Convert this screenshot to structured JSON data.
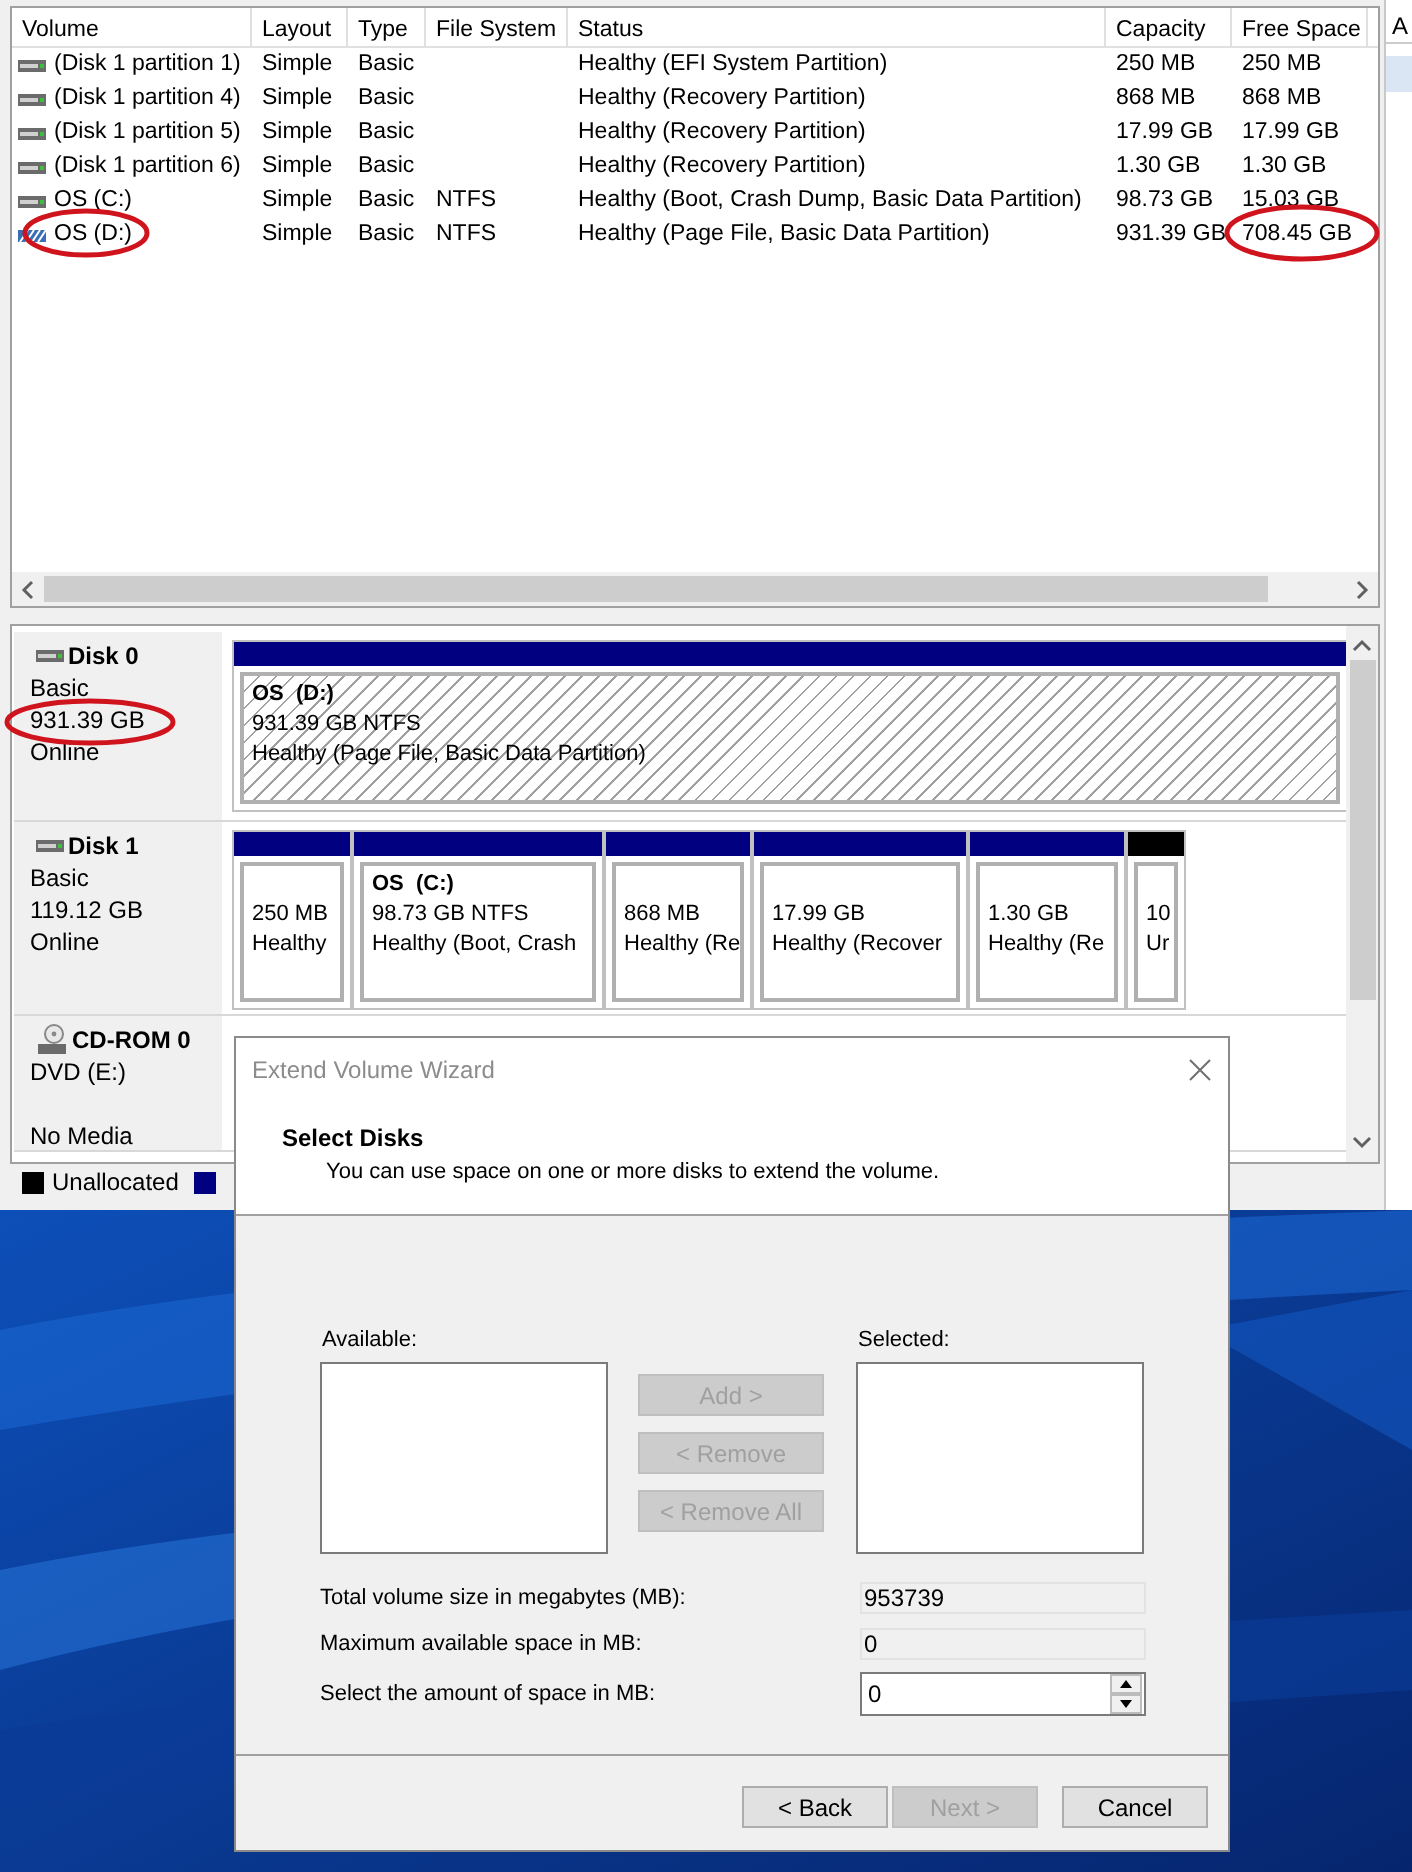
{
  "volume_list": {
    "columns": [
      "Volume",
      "Layout",
      "Type",
      "File System",
      "Status",
      "Capacity",
      "Free Space"
    ],
    "rows": [
      {
        "kind": "simple",
        "cells": [
          "(Disk 1 partition 1)",
          "Simple",
          "Basic",
          "",
          "Healthy (EFI System Partition)",
          "250 MB",
          "250 MB"
        ]
      },
      {
        "kind": "simple",
        "cells": [
          "(Disk 1 partition 4)",
          "Simple",
          "Basic",
          "",
          "Healthy (Recovery Partition)",
          "868 MB",
          "868 MB"
        ]
      },
      {
        "kind": "simple",
        "cells": [
          "(Disk 1 partition 5)",
          "Simple",
          "Basic",
          "",
          "Healthy (Recovery Partition)",
          "17.99 GB",
          "17.99 GB"
        ]
      },
      {
        "kind": "simple",
        "cells": [
          "(Disk 1 partition 6)",
          "Simple",
          "Basic",
          "",
          "Healthy (Recovery Partition)",
          "1.30 GB",
          "1.30 GB"
        ]
      },
      {
        "kind": "simple",
        "cells": [
          "OS (C:)",
          "Simple",
          "Basic",
          "NTFS",
          "Healthy (Boot, Crash Dump, Basic Data Partition)",
          "98.73 GB",
          "15.03 GB"
        ]
      },
      {
        "kind": "spanned",
        "cells": [
          "OS (D:)",
          "Simple",
          "Basic",
          "NTFS",
          "Healthy (Page File, Basic Data Partition)",
          "931.39 GB",
          "708.45 GB"
        ]
      }
    ]
  },
  "disks": [
    {
      "kind": "disk",
      "name": "Disk 0",
      "lines": [
        "Basic",
        "931.39 GB",
        "Online"
      ],
      "partitions": [
        {
          "kind": "spanned",
          "title": "OS  (D:)",
          "lines": [
            "931.39 GB NTFS",
            "Healthy (Page File, Basic Data Partition)"
          ]
        }
      ]
    },
    {
      "kind": "disk",
      "name": "Disk 1",
      "lines": [
        "Basic",
        "119.12 GB",
        "Online"
      ],
      "partitions": [
        {
          "kind": "primary",
          "lines": [
            "250 MB",
            "Healthy"
          ]
        },
        {
          "kind": "primary",
          "title": "OS  (C:)",
          "lines": [
            "98.73 GB NTFS",
            "Healthy (Boot, Crash"
          ]
        },
        {
          "kind": "primary",
          "lines": [
            "868 MB",
            "Healthy (Re"
          ]
        },
        {
          "kind": "primary",
          "lines": [
            "17.99 GB",
            "Healthy (Recover"
          ]
        },
        {
          "kind": "primary",
          "lines": [
            "1.30 GB",
            "Healthy (Re"
          ]
        },
        {
          "kind": "unallocated",
          "lines": [
            "10",
            "Ur"
          ]
        }
      ]
    },
    {
      "kind": "cdrom",
      "name": "CD-ROM 0",
      "lines": [
        "DVD (E:)",
        "No Media"
      ]
    }
  ],
  "legend": [
    {
      "label": "Unallocated",
      "color": "#000000"
    },
    {
      "color": "#000080"
    }
  ],
  "actions_pane": {
    "title": "A"
  },
  "dialog": {
    "title": "Extend Volume Wizard",
    "heading": "Select Disks",
    "subtitle": "You can use space on one or more disks to extend the volume.",
    "available_label": "Available:",
    "selected_label": "Selected:",
    "move_buttons": [
      {
        "label": "Add >",
        "disabled": true
      },
      {
        "label": "< Remove",
        "disabled": true
      },
      {
        "label": "< Remove All",
        "disabled": true
      }
    ],
    "fields": [
      {
        "kind": "readonly",
        "label": "Total volume size in megabytes (MB):",
        "value": "953739"
      },
      {
        "kind": "readonly",
        "label": "Maximum available space in MB:",
        "value": "0"
      },
      {
        "kind": "spinner",
        "label": "Select the amount of space in MB:",
        "value": "0"
      }
    ],
    "footer_buttons": [
      {
        "label": "< Back",
        "disabled": false
      },
      {
        "label": "Next >",
        "disabled": true
      },
      {
        "label": "Cancel",
        "disabled": false
      }
    ]
  }
}
